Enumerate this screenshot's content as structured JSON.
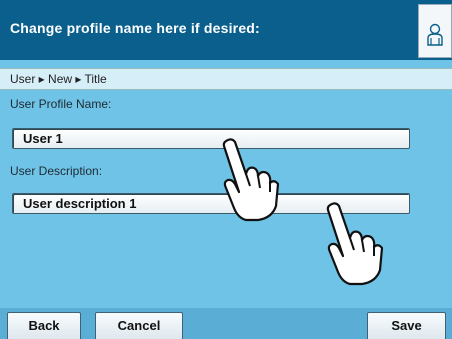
{
  "header": {
    "title": "Change profile name here if desired:",
    "icon": "user-profile-icon"
  },
  "breadcrumb": {
    "text": "User ▸ New ▸ Title"
  },
  "form": {
    "profile_name_label": "User Profile Name:",
    "profile_name_value": "User 1",
    "description_label": "User Description:",
    "description_value": "User description  1"
  },
  "toolbar": {
    "back_label": "Back",
    "cancel_label": "Cancel",
    "save_label": "Save"
  },
  "colors": {
    "header_bg": "#0a5f8c",
    "content_bg": "#6fc3e6",
    "breadcrumb_bg": "#d6eef8"
  }
}
